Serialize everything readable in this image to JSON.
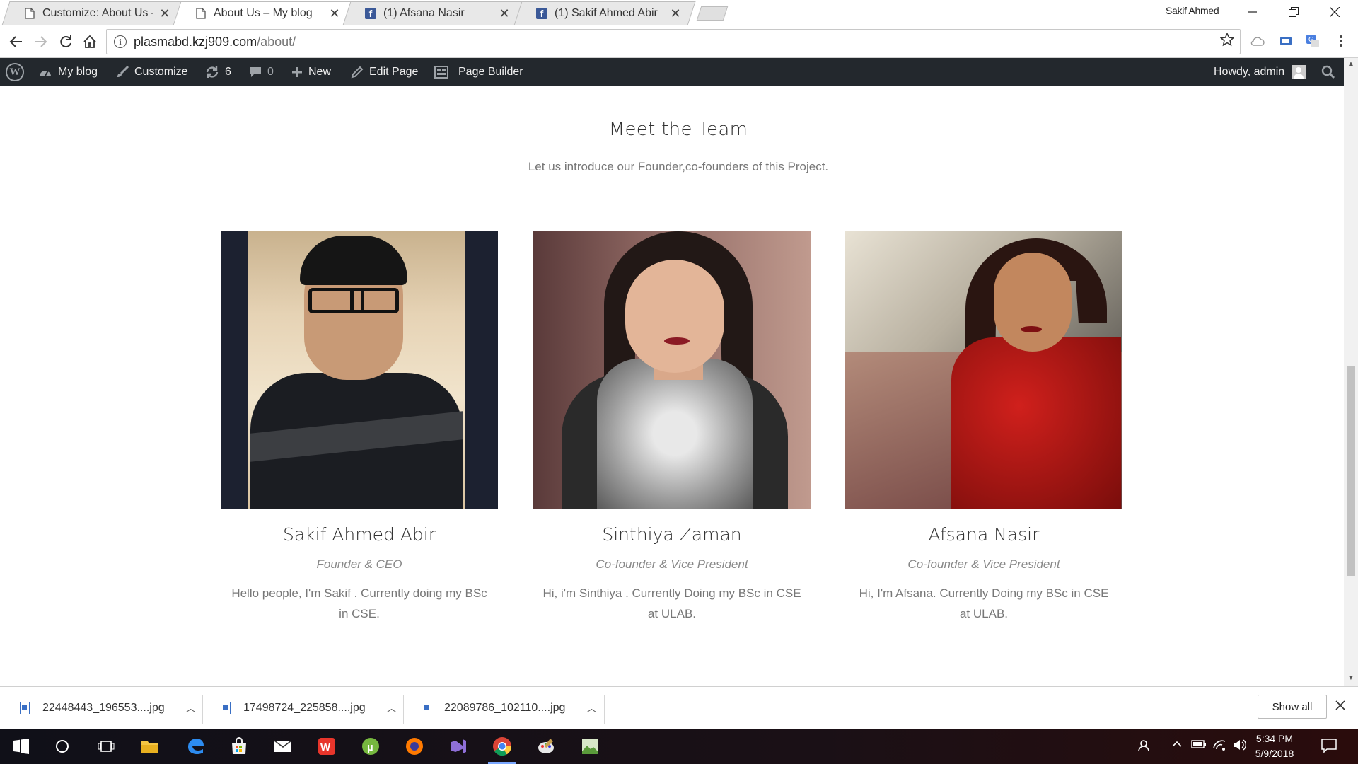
{
  "browser": {
    "tabs": [
      {
        "title": "Customize: About Us – M",
        "icon": "page-icon",
        "active": false
      },
      {
        "title": "About Us – My blog",
        "icon": "page-icon",
        "active": true
      },
      {
        "title": "(1) Afsana Nasir",
        "icon": "facebook-icon",
        "active": false
      },
      {
        "title": "(1) Sakif Ahmed Abir",
        "icon": "facebook-icon",
        "active": false
      }
    ],
    "close_glyph": "✕",
    "profile_name": "Sakif Ahmed",
    "url_host": "plasmabd.kzj909.com",
    "url_path": "/about/"
  },
  "adminbar": {
    "site_label": "My blog",
    "customize_label": "Customize",
    "updates_count": "6",
    "comments_count": "0",
    "new_label": "New",
    "edit_label": "Edit Page",
    "builder_label": "Page Builder",
    "howdy_label": "Howdy, admin"
  },
  "section": {
    "title": "Meet the Team",
    "subtitle": "Let us introduce our Founder,co-founders of this Project."
  },
  "team": [
    {
      "name": "Sakif Ahmed Abir",
      "role": "Founder & CEO",
      "bio": "Hello people, I'm Sakif . Currently doing my BSc in CSE."
    },
    {
      "name": "Sinthiya Zaman",
      "role": "Co-founder & Vice President",
      "bio": "Hi, i'm Sinthiya . Currently Doing my BSc in CSE at ULAB."
    },
    {
      "name": "Afsana Nasir",
      "role": "Co-founder & Vice President",
      "bio": "Hi, I'm Afsana. Currently Doing my BSc in CSE at ULAB."
    }
  ],
  "downloads": [
    {
      "filename": "22448443_196553....jpg"
    },
    {
      "filename": "17498724_225858....jpg"
    },
    {
      "filename": "22089786_102110....jpg"
    }
  ],
  "shelf": {
    "show_all_label": "Show all"
  },
  "taskbar": {
    "time": "5:34 PM",
    "date": "5/9/2018"
  },
  "colors": {
    "admin_bar": "#23282d",
    "facebook": "#3b5998",
    "chrome_blue": "#3a6fc4"
  }
}
